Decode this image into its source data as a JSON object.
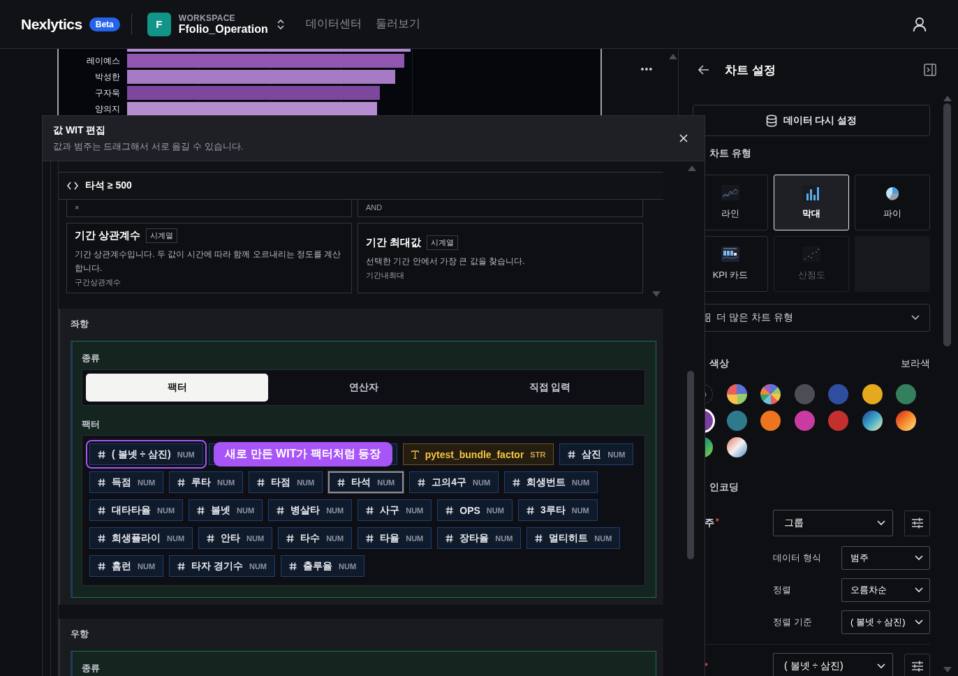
{
  "header": {
    "logo": "Nexlytics",
    "badge": "Beta",
    "workspace": {
      "avatar": "F",
      "caption": "WORKSPACE",
      "name": "Ffolio_Operation"
    },
    "nav": [
      "데이터센터",
      "둘러보기"
    ]
  },
  "background_chart": {
    "labels": [
      "레이예스",
      "박성한",
      "구자욱",
      "양의지"
    ]
  },
  "dialog": {
    "title": "값 WIT 편집",
    "subtitle": "값과 범주는 드래그해서 서로 옮길 수 있습니다.",
    "filter": "타석 ≥ 500",
    "functions": [
      {
        "code": "×"
      },
      {
        "code": "AND"
      },
      {
        "title": "기간 상관계수",
        "tag": "시계열",
        "description": "기간 상관계수입니다. 두 값이 시간에 따라 함께 오르내리는 정도를 계산합니다.",
        "code": "구간상관계수"
      },
      {
        "title": "기간 최대값",
        "tag": "시계열",
        "description": "선택한 기간 안에서 가장 큰 값을 찾습니다.",
        "code": "기간내최대"
      }
    ],
    "left_operand": {
      "heading": "좌항",
      "kind_label": "종류",
      "segments": [
        {
          "label": "팩터",
          "selected": true
        },
        {
          "label": "연산자",
          "selected": false
        },
        {
          "label": "직접 입력",
          "selected": false
        }
      ],
      "factor_label": "팩터",
      "factor_rows": [
        [
          {
            "kind": "num",
            "label": "( 볼넷 ÷ 삼진)",
            "tag": "NUM",
            "selected": false,
            "highlighted": true
          },
          {
            "kind": "covered",
            "selected": false,
            "highlighted": false
          },
          {
            "kind": "str",
            "label": "pytest_bundle_factor",
            "tag": "STR",
            "selected": false,
            "highlighted": false
          },
          {
            "kind": "num",
            "label": "삼진",
            "tag": "NUM",
            "selected": false,
            "highlighted": false
          }
        ],
        [
          {
            "kind": "num",
            "label": "득점",
            "tag": "NUM",
            "selected": false,
            "highlighted": false
          },
          {
            "kind": "num",
            "label": "루타",
            "tag": "NUM",
            "selected": false,
            "highlighted": false
          },
          {
            "kind": "num",
            "label": "타점",
            "tag": "NUM",
            "selected": false,
            "highlighted": false
          },
          {
            "kind": "num",
            "label": "타석",
            "tag": "NUM",
            "selected": true,
            "highlighted": false
          },
          {
            "kind": "num",
            "label": "고의4구",
            "tag": "NUM",
            "selected": false,
            "highlighted": false
          },
          {
            "kind": "num",
            "label": "희생번트",
            "tag": "NUM",
            "selected": false,
            "highlighted": false
          }
        ],
        [
          {
            "kind": "num",
            "label": "대타타율",
            "tag": "NUM",
            "selected": false,
            "highlighted": false
          },
          {
            "kind": "num",
            "label": "볼넷",
            "tag": "NUM",
            "selected": false,
            "highlighted": false
          },
          {
            "kind": "num",
            "label": "병살타",
            "tag": "NUM",
            "selected": false,
            "highlighted": false
          },
          {
            "kind": "num",
            "label": "사구",
            "tag": "NUM",
            "selected": false,
            "highlighted": false
          },
          {
            "kind": "num",
            "label": "OPS",
            "tag": "NUM",
            "selected": false,
            "highlighted": false
          },
          {
            "kind": "num",
            "label": "3루타",
            "tag": "NUM",
            "selected": false,
            "highlighted": false
          }
        ],
        [
          {
            "kind": "num",
            "label": "희생플라이",
            "tag": "NUM",
            "selected": false,
            "highlighted": false
          },
          {
            "kind": "num",
            "label": "안타",
            "tag": "NUM",
            "selected": false,
            "highlighted": false
          },
          {
            "kind": "num",
            "label": "타수",
            "tag": "NUM",
            "selected": false,
            "highlighted": false
          },
          {
            "kind": "num",
            "label": "타율",
            "tag": "NUM",
            "selected": false,
            "highlighted": false
          },
          {
            "kind": "num",
            "label": "장타율",
            "tag": "NUM",
            "selected": false,
            "highlighted": false
          },
          {
            "kind": "num",
            "label": "멀티히트",
            "tag": "NUM",
            "selected": false,
            "highlighted": false
          }
        ],
        [
          {
            "kind": "num",
            "label": "홈런",
            "tag": "NUM",
            "selected": false,
            "highlighted": false
          },
          {
            "kind": "num",
            "label": "타자 경기수",
            "tag": "NUM",
            "selected": false,
            "highlighted": false
          },
          {
            "kind": "num",
            "label": "출루율",
            "tag": "NUM",
            "selected": false,
            "highlighted": false
          }
        ]
      ]
    },
    "tooltip": "새로 만든 WIT가 팩터처럼 등장",
    "right_operand": {
      "heading": "우항",
      "kind_label": "종류"
    }
  },
  "panel": {
    "title": "차트 설정",
    "reset_button": "데이터 다시 설정",
    "chart_type_label": "차트 유형",
    "chart_types": [
      {
        "kind": "line",
        "label": "라인",
        "selected": false,
        "disabled": false
      },
      {
        "kind": "bar",
        "label": "막대",
        "selected": true,
        "disabled": false
      },
      {
        "kind": "pie",
        "label": "파이",
        "selected": false,
        "disabled": false
      },
      {
        "kind": "kpi",
        "label": "KPI 카드",
        "selected": false,
        "disabled": false
      },
      {
        "kind": "scatter",
        "label": "산점도",
        "selected": false,
        "disabled": true
      },
      {
        "kind": "empty"
      }
    ],
    "more_types": "더 많은 차트 유형",
    "color_label": "색상",
    "color_value": "보라색",
    "swatches": [
      {
        "kind": "auto",
        "selected": false
      },
      {
        "kind": "quad",
        "selected": false
      },
      {
        "kind": "wheel",
        "selected": false
      },
      {
        "kind": "solid",
        "color": "#4b4e55",
        "selected": false
      },
      {
        "kind": "solid",
        "color": "#2f4ea0",
        "selected": false
      },
      {
        "kind": "solid",
        "color": "#e5a91e",
        "selected": false
      },
      {
        "kind": "solid",
        "color": "#35805c",
        "selected": false
      },
      {
        "kind": "solid",
        "color": "#7b3fa0",
        "selected": true
      },
      {
        "kind": "solid",
        "color": "#2e7a8c",
        "selected": false
      },
      {
        "kind": "solid",
        "color": "#ee7420",
        "selected": false
      },
      {
        "kind": "solid",
        "color": "#c93ba0",
        "selected": false
      },
      {
        "kind": "solid",
        "color": "#c4302e",
        "selected": false
      },
      {
        "kind": "ocean",
        "selected": false
      },
      {
        "kind": "sunset",
        "selected": false
      },
      {
        "kind": "meadow",
        "selected": false
      },
      {
        "kind": "pastel",
        "selected": false
      }
    ],
    "encoding_label": "인코딩",
    "encodings": [
      {
        "label": "주",
        "marker": "*",
        "value": "그룹",
        "options": [
          {
            "label": "데이터 형식",
            "value": "범주"
          },
          {
            "label": "정렬",
            "value": "오름차순"
          },
          {
            "label": "정렬 기준",
            "value": "( 볼넷 ÷ 삼진)"
          }
        ]
      },
      {
        "marker": "*",
        "value": "( 볼넷 ÷ 삼진)"
      }
    ]
  }
}
